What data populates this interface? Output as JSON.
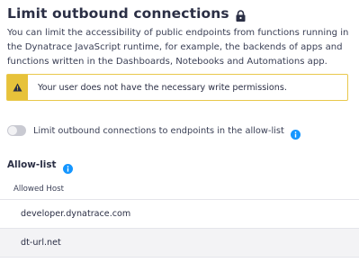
{
  "header": {
    "title": "Limit outbound connections",
    "lock_icon": "lock-icon"
  },
  "description": "You can limit the accessibility of public endpoints from functions running in the Dynatrace JavaScript runtime, for example, the backends of apps and functions written in the Dashboards, Notebooks and Automations app.",
  "warning": {
    "icon": "warning-triangle-icon",
    "text": "Your user does not have the necessary write permissions.",
    "accent_color": "#e7c23a"
  },
  "toggle": {
    "label": "Limit outbound connections to endpoints in the allow-list",
    "state": "off",
    "disabled": true,
    "info_icon": "info-icon"
  },
  "allow_list": {
    "title": "Allow-list",
    "info_icon": "info-icon",
    "column_header": "Allowed Host",
    "rows": [
      {
        "host": "developer.dynatrace.com"
      },
      {
        "host": "dt-url.net"
      }
    ]
  },
  "colors": {
    "info": "#1496ff",
    "warning": "#e7c23a",
    "text": "#2b2f45"
  }
}
